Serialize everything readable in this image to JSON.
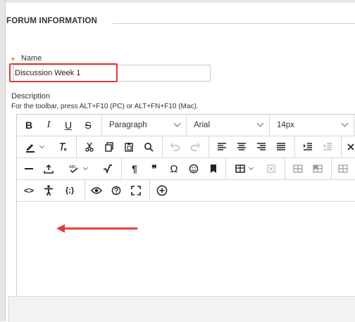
{
  "section": {
    "title": "FORUM INFORMATION"
  },
  "name_field": {
    "required_mark": "*",
    "label": "Name",
    "value": "Discussion Week 1"
  },
  "description": {
    "label": "Description",
    "hint": "For the toolbar, press ALT+F10 (PC) or ALT+FN+F10 (Mac)."
  },
  "toolbar": {
    "bold": "B",
    "italic": "I",
    "underline": "U",
    "strike": "S",
    "paragraph": "Paragraph",
    "font": "Arial",
    "size": "14px",
    "paragraph_mark": "¶",
    "quote": "❞",
    "omega": "Ω",
    "source_code": "<>",
    "code": "{;}"
  },
  "colors": {
    "highlight_red": "#e3393b",
    "required_orange": "#e8770f"
  }
}
